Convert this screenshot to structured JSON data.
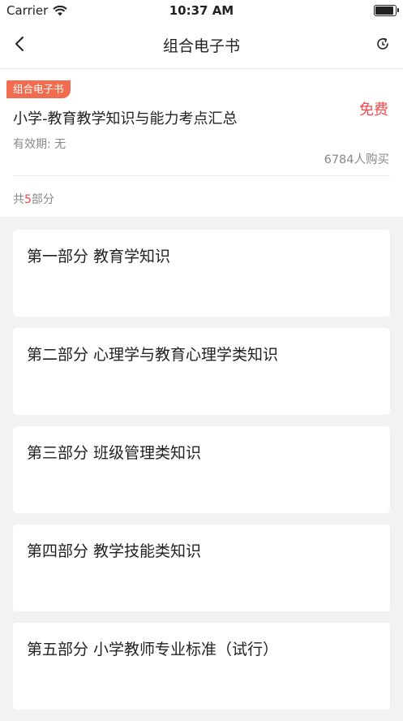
{
  "status_bar": {
    "carrier": "Carrier",
    "time": "10:37 AM"
  },
  "nav": {
    "title": "组合电子书"
  },
  "book": {
    "tag": "组合电子书",
    "title": "小学-教育教学知识与能力考点汇总",
    "price": "免费",
    "validity": "有效期: 无",
    "buyers": "6784人购买",
    "parts_prefix": "共",
    "parts_count": "5",
    "parts_suffix": "部分"
  },
  "parts": [
    {
      "title": "第一部分 教育学知识"
    },
    {
      "title": "第二部分 心理学与教育心理学类知识"
    },
    {
      "title": "第三部分 班级管理类知识"
    },
    {
      "title": "第四部分 教学技能类知识"
    },
    {
      "title": "第五部分 小学教师专业标准（试行）"
    }
  ]
}
